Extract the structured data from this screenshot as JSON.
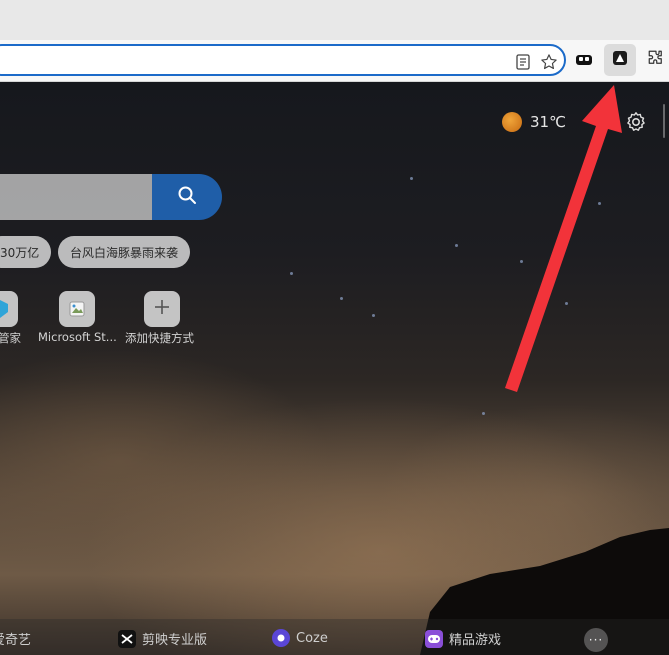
{
  "toolbar": {
    "address_value": "",
    "icons": [
      "reader-mode-icon",
      "favorite-star-icon",
      "extension-toolbox-icon",
      "extension-active-icon",
      "extensions-puzzle-icon"
    ]
  },
  "weather": {
    "temperature": "31℃",
    "icon": "sun-icon"
  },
  "search": {
    "button_icon": "search-icon"
  },
  "trending": [
    {
      "label": "30万亿"
    },
    {
      "label": "台风白海豚暴雨来袭"
    }
  ],
  "shortcuts": [
    {
      "label": "管家"
    },
    {
      "label": "Microsoft St..."
    },
    {
      "label": "添加快捷方式"
    }
  ],
  "bottom_bar": [
    {
      "label": "爱奇艺"
    },
    {
      "label": "剪映专业版"
    },
    {
      "label": "Coze"
    },
    {
      "label": "精品游戏"
    }
  ],
  "more_label": "···",
  "colors": {
    "accent_blue": "#1f5ea8",
    "arrow_red": "#f2333a",
    "address_border": "#1b6ac9"
  }
}
